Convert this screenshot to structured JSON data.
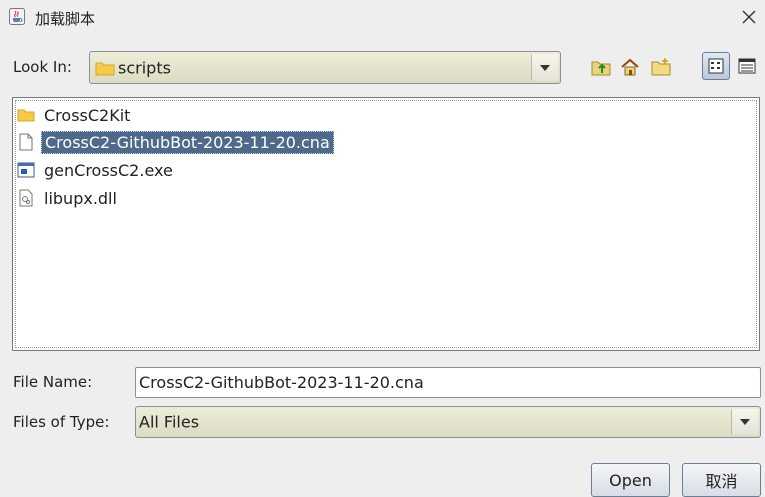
{
  "window": {
    "title": "加载脚本",
    "app_icon": "java-cup-icon",
    "close_icon": "close-icon"
  },
  "look_in": {
    "label": "Look In:",
    "value": "scripts",
    "folder_icon": "folder-icon"
  },
  "toolbar": {
    "icons": [
      "up-folder-icon",
      "home-icon",
      "new-folder-icon",
      "list-view-icon",
      "details-view-icon"
    ]
  },
  "files": [
    {
      "name": "CrossC2Kit",
      "icon": "folder-icon",
      "selected": false
    },
    {
      "name": "CrossC2-GithubBot-2023-11-20.cna",
      "icon": "file-icon",
      "selected": true
    },
    {
      "name": "genCrossC2.exe",
      "icon": "executable-icon",
      "selected": false
    },
    {
      "name": "libupx.dll",
      "icon": "dll-icon",
      "selected": false
    }
  ],
  "file_name": {
    "label": "File Name:",
    "value": "CrossC2-GithubBot-2023-11-20.cna"
  },
  "file_type": {
    "label": "Files of Type:",
    "value": "All Files"
  },
  "buttons": {
    "open": "Open",
    "cancel": "取消"
  },
  "colors": {
    "selection": "#4e6a8a",
    "combo": "#dcdcc4"
  }
}
